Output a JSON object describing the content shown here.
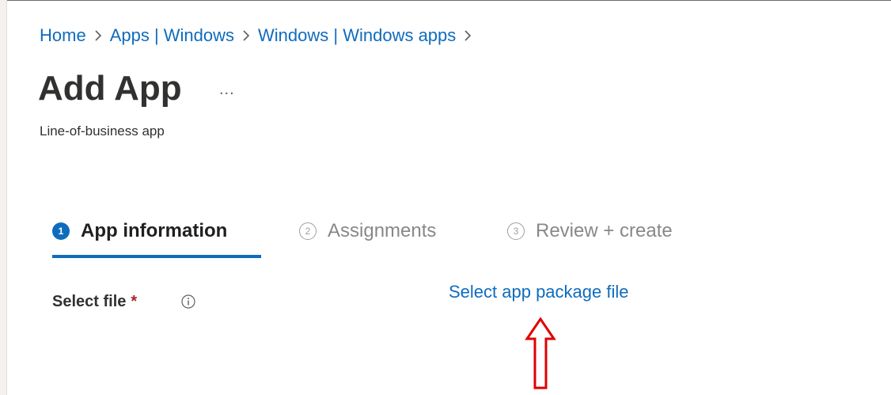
{
  "breadcrumb": [
    "Home",
    "Apps | Windows",
    "Windows | Windows apps"
  ],
  "page": {
    "title": "Add App",
    "more": "...",
    "subtitle": "Line-of-business app"
  },
  "steps": [
    {
      "number": "1",
      "label": "App information",
      "active": true
    },
    {
      "number": "2",
      "label": "Assignments",
      "active": false
    },
    {
      "number": "3",
      "label": "Review + create",
      "active": false
    }
  ],
  "form": {
    "select_file_label": "Select file",
    "required_marker": "*",
    "select_link": "Select app package file"
  },
  "icons": {
    "breadcrumb_separator": "chevron-right-icon",
    "info": "info-icon",
    "annotation": "red-arrow-up-icon"
  },
  "colors": {
    "link": "#0f6cbd",
    "accent": "#0f6cbd",
    "required": "#a4262c",
    "annotation": "#e00000"
  }
}
